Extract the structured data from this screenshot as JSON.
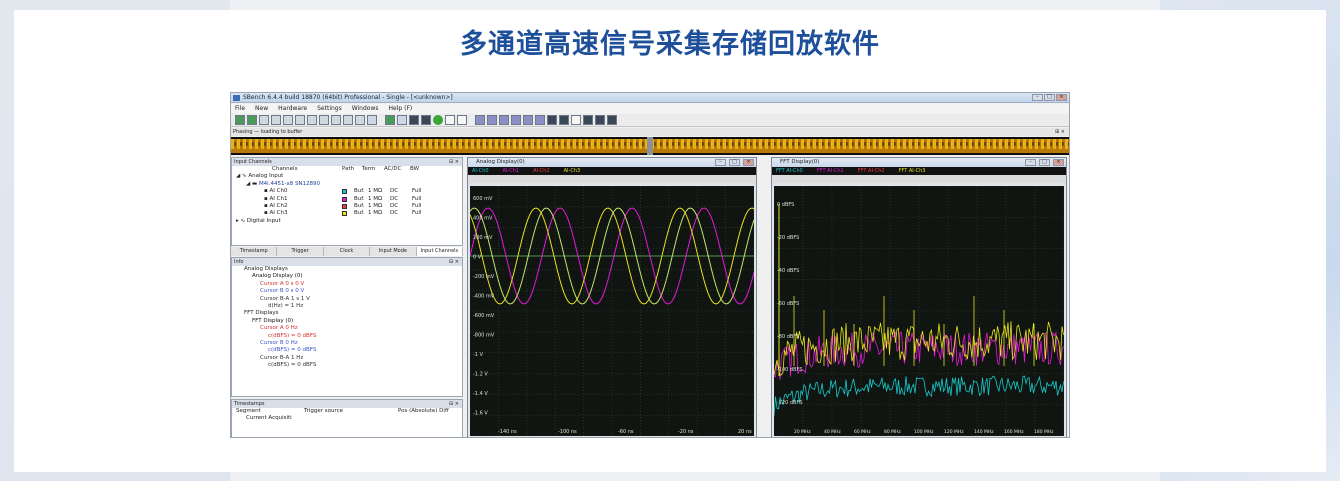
{
  "page": {
    "heading": "多通道高速信号采集存储回放软件"
  },
  "app": {
    "title": "SBench 6.4.4 build 18870 (64bit) Professional - Single - [<unknown>]",
    "menu": [
      "File",
      "New",
      "Hardware",
      "Settings",
      "Windows",
      "Help (F)"
    ],
    "phase_label": "Phasing — loading to buffer",
    "window_buttons": [
      "–",
      "□",
      "×"
    ]
  },
  "input_channels": {
    "title": "Input Channels",
    "columns": [
      "Channels",
      "Path",
      "Term",
      "AC/DC",
      "BW"
    ],
    "group": "Analog Input",
    "card": "M4i.4451-x8 SN12890",
    "rows": [
      {
        "name": "AI Ch0",
        "path": "Buf.",
        "term": "1 MΩ",
        "coupling": "DC",
        "bw": "Full",
        "color": "#19c9c9"
      },
      {
        "name": "AI Ch1",
        "path": "Buf.",
        "term": "1 MΩ",
        "coupling": "DC",
        "bw": "Full",
        "color": "#e21ad8"
      },
      {
        "name": "AI Ch2",
        "path": "Buf.",
        "term": "1 MΩ",
        "coupling": "DC",
        "bw": "Full",
        "color": "#f23a3a"
      },
      {
        "name": "AI Ch3",
        "path": "Buf.",
        "term": "1 MΩ",
        "coupling": "DC",
        "bw": "Full",
        "color": "#e8e41c"
      }
    ],
    "digital": "Digital Input"
  },
  "tabs": [
    "Timestamp",
    "Trigger",
    "Clock",
    "Input Mode",
    "Input Channels"
  ],
  "info": {
    "title": "Info",
    "lines": [
      {
        "text": "Analog Displays",
        "indent": 1,
        "color": "#222222"
      },
      {
        "text": "Analog Display (0)",
        "indent": 2,
        "color": "#111111"
      },
      {
        "text": "Cursor A  0 s  0 V",
        "indent": 3,
        "color": "#d23030"
      },
      {
        "text": "Cursor B  0 s  0 V",
        "indent": 3,
        "color": "#3b55c9"
      },
      {
        "text": "Cursor B-A  1 s  1 V",
        "indent": 3,
        "color": "#333333"
      },
      {
        "text": "d(Hz) = 1 Hz",
        "indent": 4,
        "color": "#333333"
      },
      {
        "text": "FFT Displays",
        "indent": 1,
        "color": "#222222"
      },
      {
        "text": "FFT Display (0)",
        "indent": 2,
        "color": "#111111"
      },
      {
        "text": "Cursor A  0 Hz",
        "indent": 3,
        "color": "#d23030"
      },
      {
        "text": "c(dBFS) = 0 dBFS",
        "indent": 4,
        "color": "#d23030"
      },
      {
        "text": "Cursor B  0 Hz",
        "indent": 3,
        "color": "#3b55c9"
      },
      {
        "text": "c(dBFS) = 0 dBFS",
        "indent": 4,
        "color": "#3b55c9"
      },
      {
        "text": "Cursor B-A  1 Hz",
        "indent": 3,
        "color": "#333333"
      },
      {
        "text": "c(dBFS) = 0 dBFS",
        "indent": 4,
        "color": "#333333"
      }
    ]
  },
  "timestamps": {
    "title": "Timestamps",
    "col_segment": "Segment",
    "col_trigger": "Trigger source",
    "col_pos": "Pos (Absolute)  Diff",
    "row": "Current Acquisiti"
  },
  "analog_display": {
    "title": "Analog Display(0)",
    "legend": [
      {
        "label": "AI-Ch0",
        "color": "#19c9c9"
      },
      {
        "label": "AI-Ch1",
        "color": "#e21ad8"
      },
      {
        "label": "AI-Ch2",
        "color": "#f23a3a"
      },
      {
        "label": "AI-Ch3",
        "color": "#e8e41c"
      }
    ],
    "y_ticks": [
      "600 mV",
      "400 mV",
      "200 mV",
      "0 V",
      "-200 mV",
      "-400 mV",
      "-600 mV",
      "-800 mV",
      "-1 V",
      "-1.2 V",
      "-1.4 V",
      "-1.6 V"
    ],
    "x_ticks": [
      "-140 ns",
      "-100 ns",
      "-60 ns",
      "-20 ns",
      "20 ns"
    ]
  },
  "fft_display": {
    "title": "FFT Display(0)",
    "legend": [
      {
        "label": "FFT AI-Ch0",
        "color": "#19c9c9"
      },
      {
        "label": "FFT AI-Ch1",
        "color": "#e21ad8"
      },
      {
        "label": "FFT AI-Ch2",
        "color": "#f23a3a"
      },
      {
        "label": "FFT AI-Ch3",
        "color": "#e8e41c"
      }
    ],
    "y_ticks": [
      "0 dBFS",
      "-20 dBFS",
      "-40 dBFS",
      "-60 dBFS",
      "-80 dBFS",
      "-100 dBFS",
      "-120 dBFS"
    ],
    "x_ticks": [
      "20 MHz",
      "40 MHz",
      "60 MHz",
      "80 MHz",
      "100 MHz",
      "120 MHz",
      "140 MHz",
      "160 MHz",
      "180 MHz"
    ]
  }
}
